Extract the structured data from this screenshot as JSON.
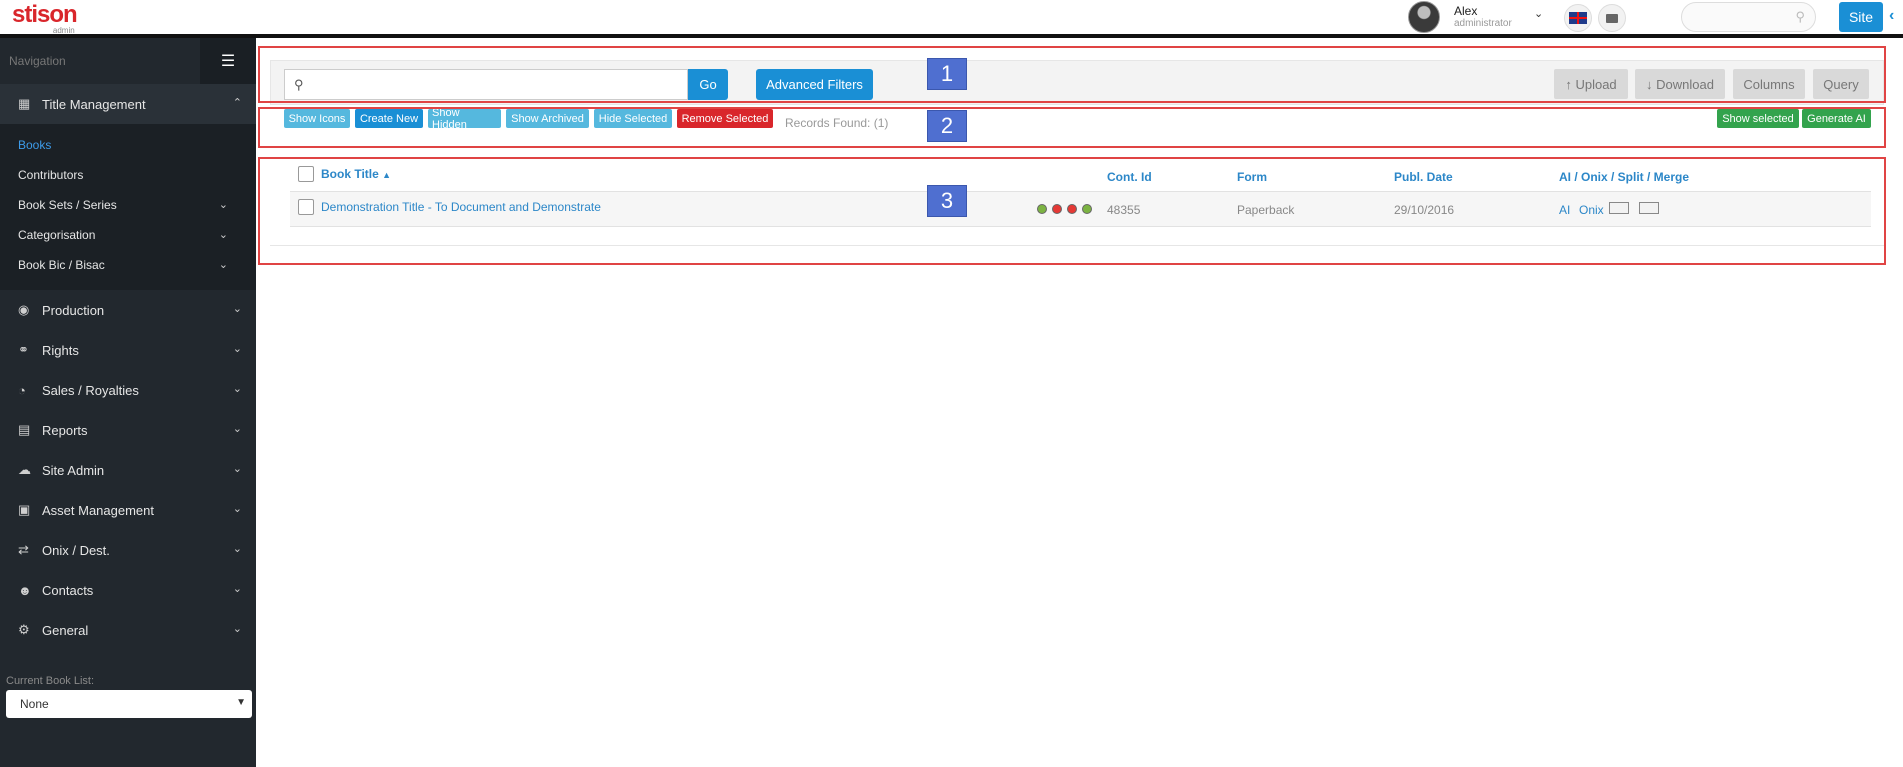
{
  "logo": {
    "brand": "stison",
    "sub": "admin"
  },
  "user": {
    "name": "Alex",
    "role": "administrator"
  },
  "header": {
    "site_label": "Site",
    "search_placeholder": ""
  },
  "sidebar": {
    "nav_title": "Navigation",
    "title_management": "Title Management",
    "sub_items": [
      {
        "label": "Books"
      },
      {
        "label": "Contributors"
      },
      {
        "label": "Book Sets / Series"
      },
      {
        "label": "Categorisation"
      },
      {
        "label": "Book Bic / Bisac"
      }
    ],
    "sections": [
      {
        "label": "Production",
        "icon": "palette-icon"
      },
      {
        "label": "Rights",
        "icon": "link-icon"
      },
      {
        "label": "Sales / Royalties",
        "icon": "pie-chart-icon"
      },
      {
        "label": "Reports",
        "icon": "document-icon"
      },
      {
        "label": "Site Admin",
        "icon": "cloud-icon"
      },
      {
        "label": "Asset Management",
        "icon": "image-icon"
      },
      {
        "label": "Onix / Dest.",
        "icon": "exchange-icon"
      },
      {
        "label": "Contacts",
        "icon": "users-icon"
      },
      {
        "label": "General",
        "icon": "cogs-icon"
      }
    ],
    "book_list_label": "Current Book List:",
    "book_list_value": "None"
  },
  "toolbar": {
    "search_value": "",
    "go_label": "Go",
    "advanced_filters_label": "Advanced Filters",
    "upload_label": "↑ Upload",
    "download_label": "↓ Download",
    "columns_label": "Columns",
    "query_label": "Query"
  },
  "actions": {
    "show_icons": "Show Icons",
    "create_new": "Create New",
    "show_hidden": "Show Hidden",
    "show_archived": "Show Archived",
    "hide_selected": "Hide Selected",
    "remove_selected": "Remove Selected",
    "records_found": "Records Found: (1)",
    "show_selected": "Show selected",
    "generate_ai": "Generate AI"
  },
  "table": {
    "headers": {
      "book_title": "Book Title",
      "cont_id": "Cont. Id",
      "form": "Form",
      "publ_date": "Publ. Date",
      "ai_onix": "AI / Onix / Split / Merge"
    },
    "rows": [
      {
        "title": "Demonstration Title - To Document and Demonstrate",
        "cont_id": "48355",
        "form": "Paperback",
        "publ_date": "29/10/2016",
        "ai": "AI",
        "onix": "Onix",
        "status_colors": [
          "#7cb342",
          "#e53935",
          "#e53935",
          "#7cb342"
        ]
      }
    ]
  },
  "annotations": {
    "marker1": "1",
    "marker2": "2",
    "marker3": "3"
  },
  "colors": {
    "accent": "#1a8fd5",
    "danger": "#d9262b",
    "success": "#33a34d",
    "annotation": "#e04444"
  }
}
